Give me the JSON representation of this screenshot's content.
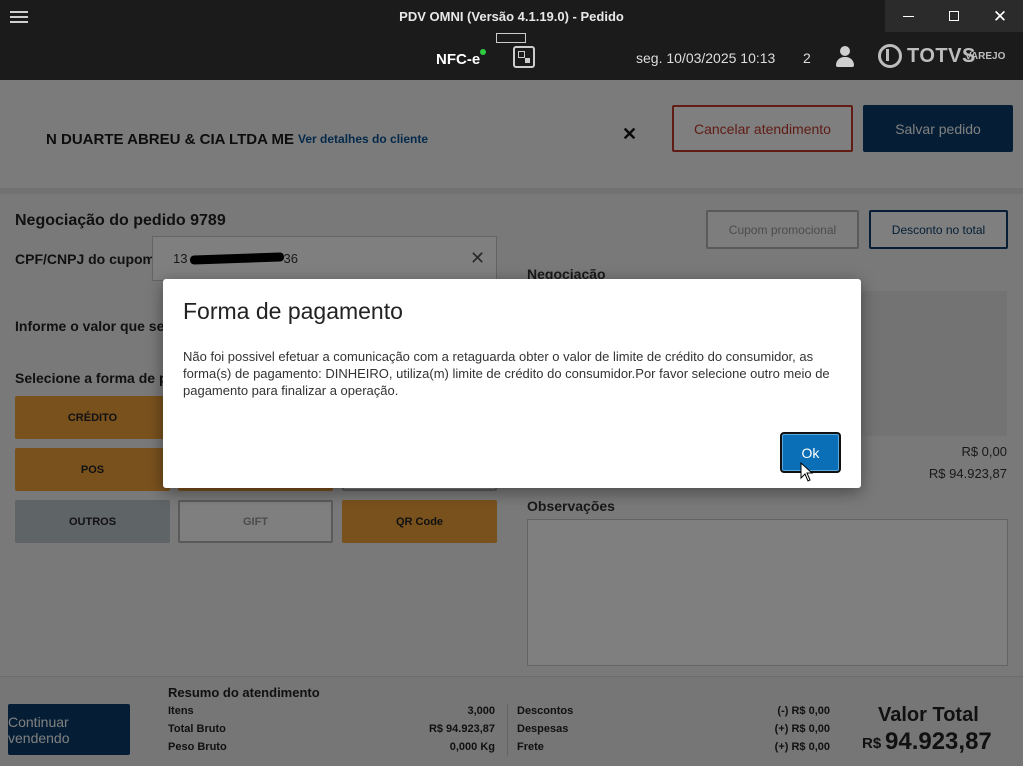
{
  "window": {
    "title": "PDV OMNI (Versão 4.1.19.0) - Pedido"
  },
  "header": {
    "nfce_label": "NFC-e",
    "datetime": "seg. 10/03/2025 10:13",
    "user_count": "2",
    "brand": "TOTVS",
    "brand_sub": "VAREJO",
    "status_color": "#2ecc40"
  },
  "client": {
    "name": "N DUARTE ABREU & CIA LTDA ME",
    "details_link": "Ver detalhes do cliente",
    "close_symbol": "✕"
  },
  "actions": {
    "cancel_label": "Cancelar atendimento",
    "save_label": "Salvar pedido",
    "cancel_color": "#c0392b",
    "primary_color": "#0b3d6b"
  },
  "negotiation": {
    "title": "Negociação do pedido 9789",
    "coupon_button": "Cupom promocional",
    "discount_button": "Desconto no total",
    "cpf_label": "CPF/CNPJ do cupom",
    "cpf_value_start": "13",
    "cpf_value_end": "36",
    "inform_label": "Informe o valor que ser",
    "select_label": "Selecione a forma de pa",
    "section_label": "Negociação",
    "value_line1": "R$ 0,00",
    "value_line2": "R$ 94.923,87",
    "notes_label": "Observações"
  },
  "payment_methods": [
    {
      "label": "CRÉDITO",
      "style": "orange"
    },
    {
      "label": "POS",
      "style": "orange"
    },
    {
      "label": "OUTROS",
      "style": "gray"
    },
    {
      "label": "GIFT",
      "style": "outline"
    },
    {
      "label": "QR Code",
      "style": "orange"
    }
  ],
  "footer": {
    "continue_label": "Continuar vendendo",
    "summary_title": "Resumo do atendimento",
    "left_rows": [
      {
        "label": "Itens",
        "value": "3,000"
      },
      {
        "label": "Total Bruto",
        "value": "R$ 94.923,87"
      },
      {
        "label": "Peso Bruto",
        "value": "0,000 Kg"
      }
    ],
    "right_rows": [
      {
        "label": "Descontos",
        "value": "(-) R$ 0,00"
      },
      {
        "label": "Despesas",
        "value": "(+) R$ 0,00"
      },
      {
        "label": "Frete",
        "value": "(+) R$ 0,00"
      }
    ],
    "total_label": "Valor Total",
    "total_currency": "R$",
    "total_value": "94.923,87"
  },
  "dialog": {
    "title": "Forma de pagamento",
    "message": "Não foi possivel efetuar a comunicação com a retaguarda obter o valor de limite de crédito do consumidor, as forma(s) de pagamento: DINHEIRO, utiliza(m) limite de crédito do consumidor.Por favor selecione outro meio de pagamento para finalizar a operação.",
    "ok_label": "Ok"
  }
}
